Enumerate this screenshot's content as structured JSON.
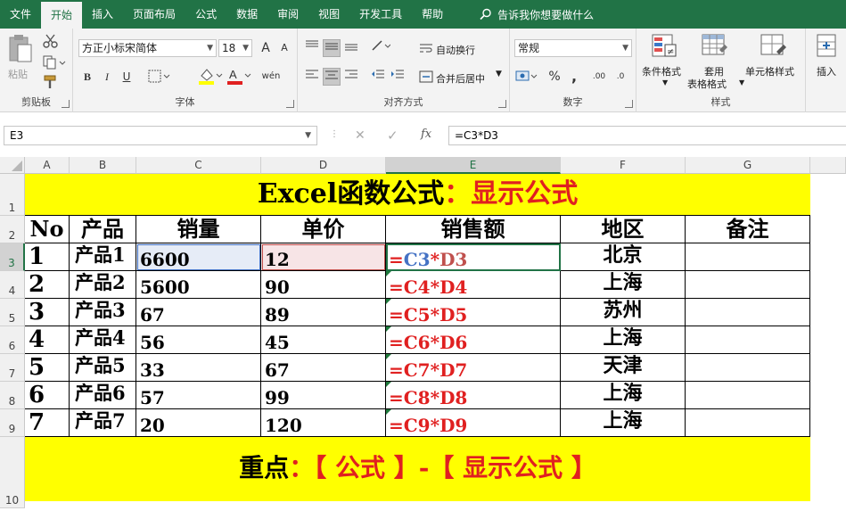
{
  "tabs": [
    "文件",
    "开始",
    "插入",
    "页面布局",
    "公式",
    "数据",
    "审阅",
    "视图",
    "开发工具",
    "帮助"
  ],
  "active_tab": "开始",
  "tell_me": "告诉我你想要做什么",
  "ribbon": {
    "clipboard": {
      "label": "剪贴板",
      "paste": "粘贴"
    },
    "font": {
      "label": "字体",
      "font_name": "方正小标宋简体",
      "font_size": "18",
      "bold": "B",
      "italic": "I",
      "underline": "U",
      "grow": "A",
      "shrink": "A",
      "phonetic": "wén"
    },
    "alignment": {
      "label": "对齐方式",
      "wrap": "自动换行",
      "merge": "合并后居中"
    },
    "number": {
      "label": "数字",
      "format": "常规",
      "percent": "%",
      "comma": ",",
      "inc_dec": ".00",
      "dec_dec": ".0"
    },
    "styles": {
      "label": "样式",
      "conditional": "条件格式",
      "table_1": "套用",
      "table_2": "表格格式",
      "cell_styles": "单元格样式"
    },
    "insert": {
      "label": "插入"
    }
  },
  "formula_bar": {
    "name_box": "E3",
    "formula": "=C3*D3",
    "fx": "fx"
  },
  "colors": {
    "accent": "#217346",
    "sheet_yellow": "#ffff00",
    "formula_red": "#e02020",
    "ref_blue": "#4472c4",
    "ref_red": "#c0504d"
  },
  "columns": [
    "A",
    "B",
    "C",
    "D",
    "E",
    "F",
    "G"
  ],
  "rows": [
    "1",
    "2",
    "3",
    "4",
    "5",
    "6",
    "7",
    "8",
    "9",
    "10"
  ],
  "sheet": {
    "title_prefix": "Excel函数公式",
    "title_sep": "：",
    "title_highlight": "显示公式",
    "headers": [
      "No",
      "产品",
      "销量",
      "单价",
      "销售额",
      "地区",
      "备注"
    ],
    "data": [
      {
        "no": "1",
        "product": "产品1",
        "qty": "6600",
        "price": "12",
        "eq": "=",
        "r1": "C3",
        "op": "*",
        "r2": "D3",
        "region": "北京"
      },
      {
        "no": "2",
        "product": "产品2",
        "qty": "5600",
        "price": "90",
        "eq": "=",
        "r1": "C4",
        "op": "*",
        "r2": "D4",
        "region": "上海"
      },
      {
        "no": "3",
        "product": "产品3",
        "qty": "67",
        "price": "89",
        "eq": "=",
        "r1": "C5",
        "op": "*",
        "r2": "D5",
        "region": "苏州"
      },
      {
        "no": "4",
        "product": "产品4",
        "qty": "56",
        "price": "45",
        "eq": "=",
        "r1": "C6",
        "op": "*",
        "r2": "D6",
        "region": "上海"
      },
      {
        "no": "5",
        "product": "产品5",
        "qty": "33",
        "price": "67",
        "eq": "=",
        "r1": "C7",
        "op": "*",
        "r2": "D7",
        "region": "天津"
      },
      {
        "no": "6",
        "product": "产品6",
        "qty": "57",
        "price": "99",
        "eq": "=",
        "r1": "C8",
        "op": "*",
        "r2": "D8",
        "region": "上海"
      },
      {
        "no": "7",
        "product": "产品7",
        "qty": "20",
        "price": "120",
        "eq": "=",
        "r1": "C9",
        "op": "*",
        "r2": "D9",
        "region": "上海"
      }
    ],
    "footer_prefix": "重点",
    "footer_sep": "：",
    "footer_highlight": "【 公式 】-【 显示公式 】"
  }
}
